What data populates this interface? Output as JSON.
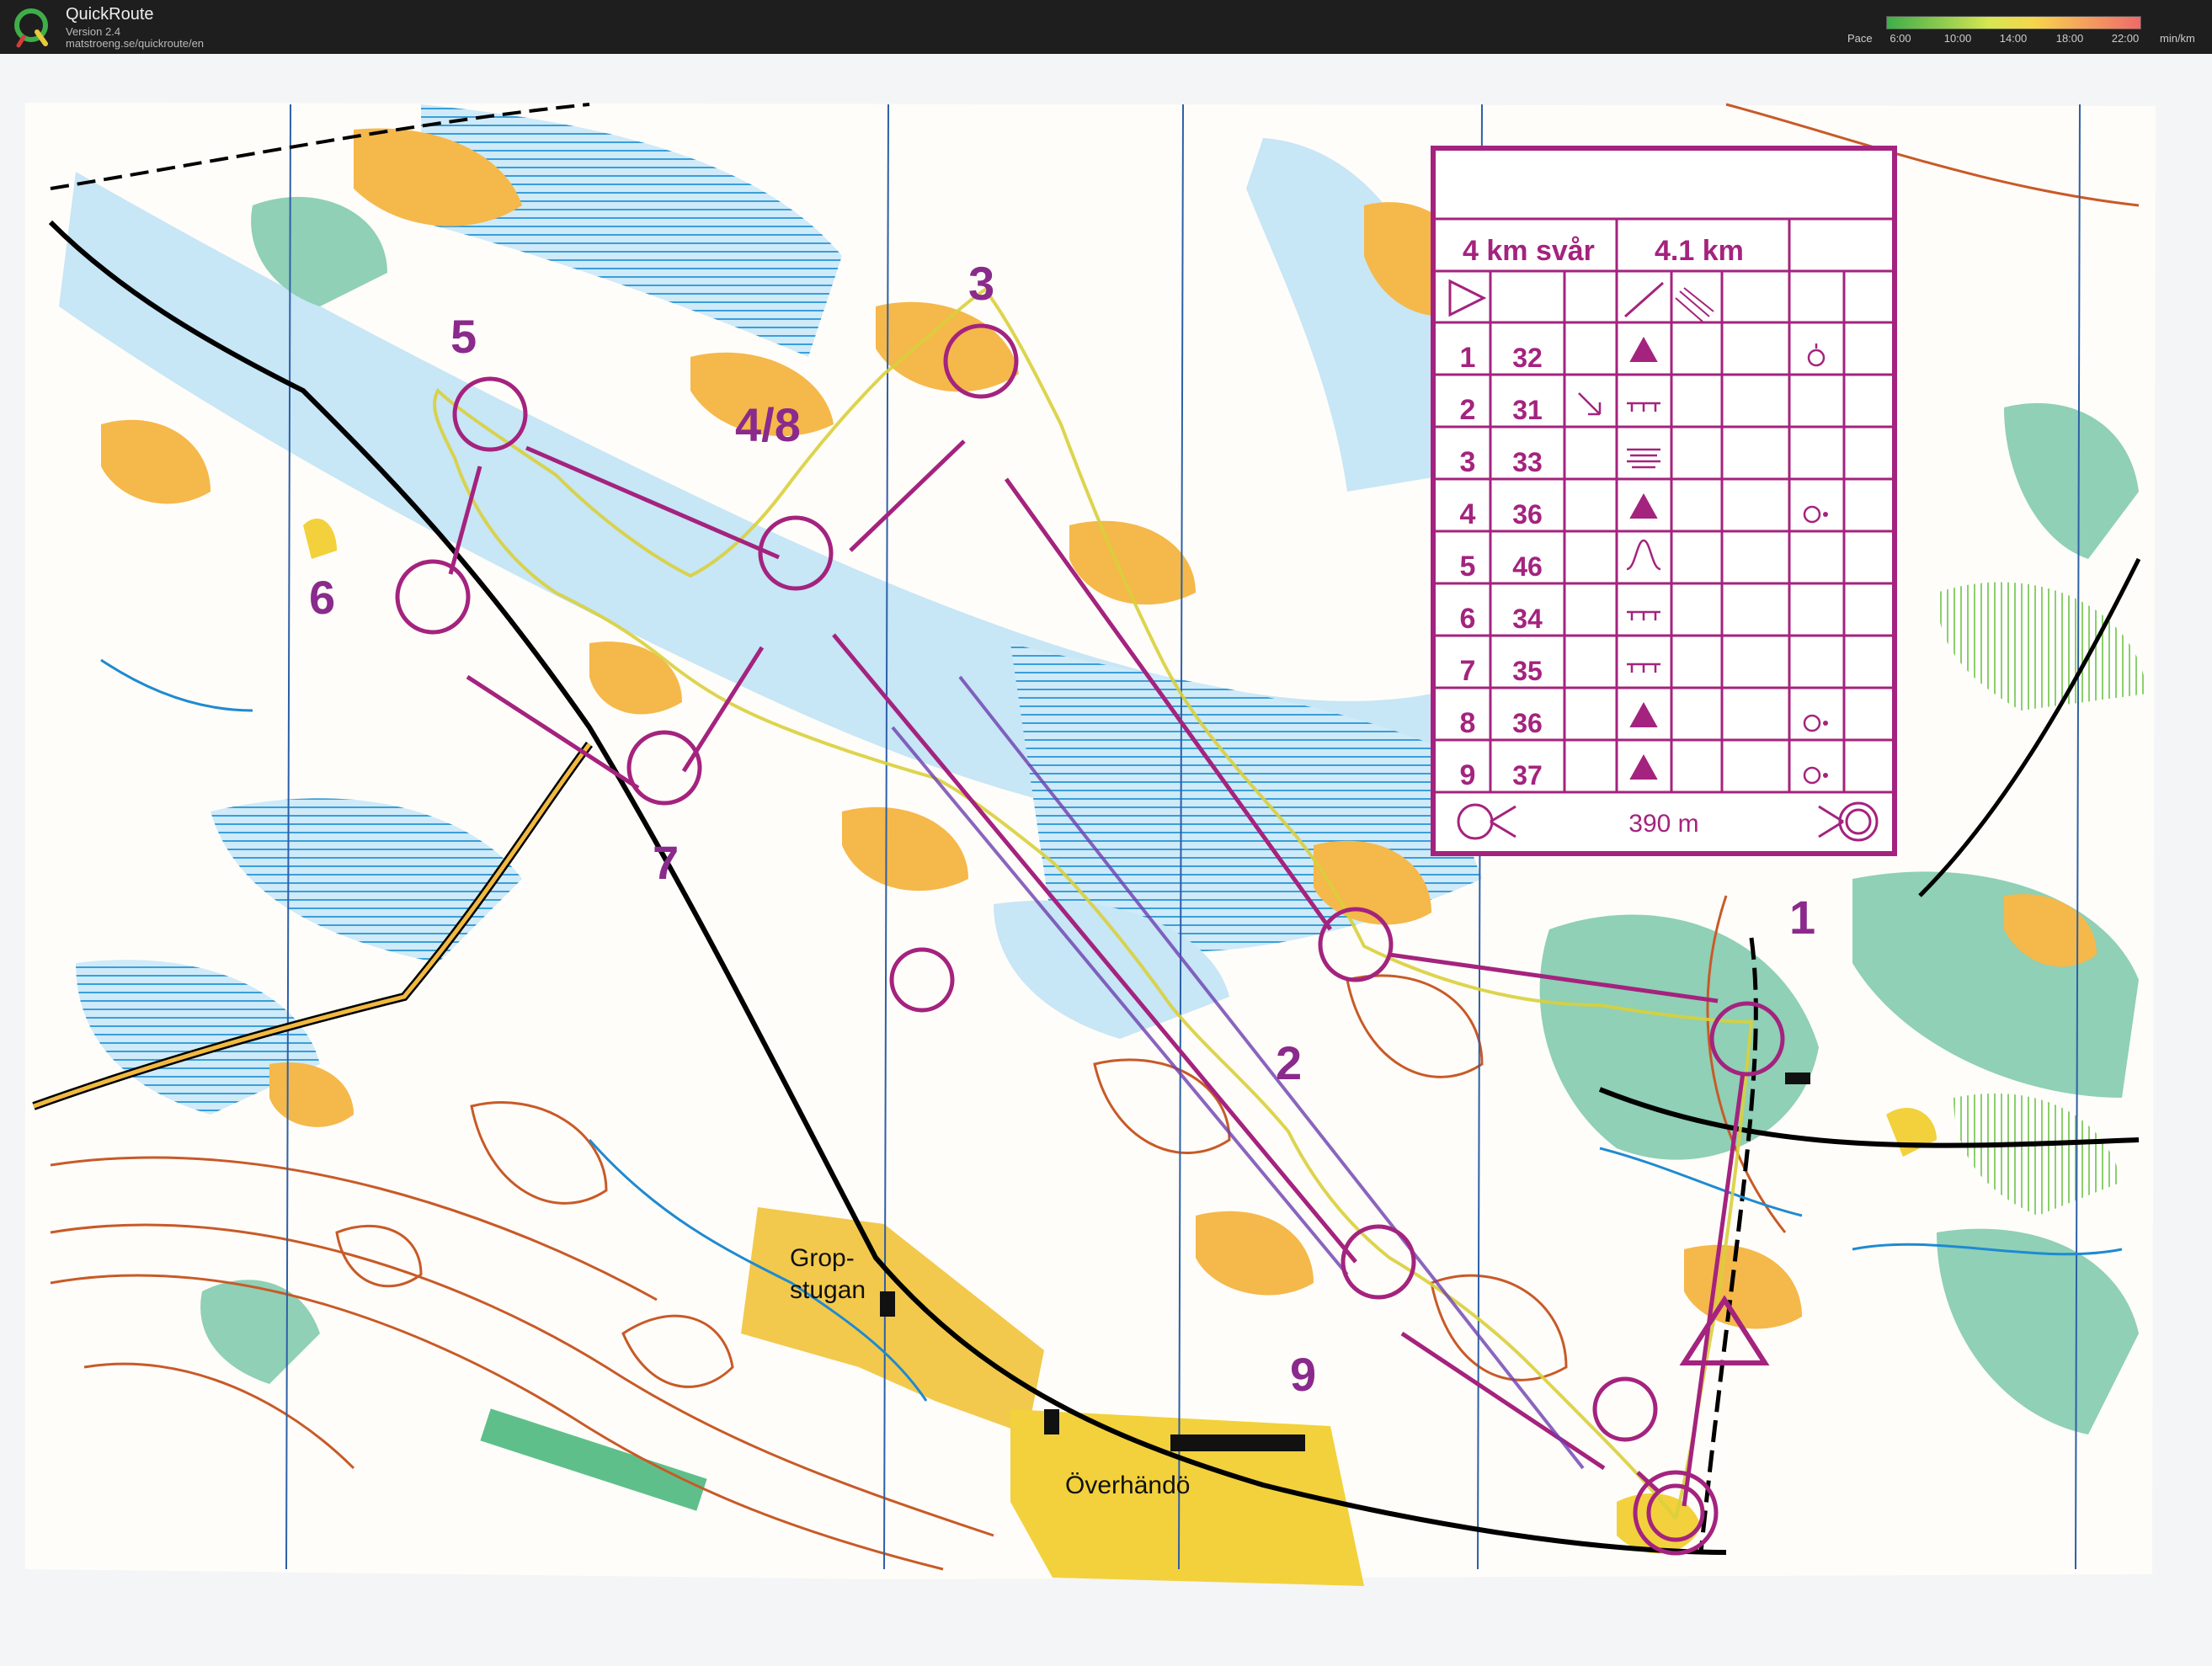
{
  "app": {
    "name": "QuickRoute",
    "version": "Version 2.4",
    "url": "matstroeng.se/quickroute/en",
    "logo_letter": "Q"
  },
  "pace_legend": {
    "label": "Pace",
    "unit": "min/km",
    "ticks": [
      "6:00",
      "10:00",
      "14:00",
      "18:00",
      "22:00"
    ]
  },
  "map": {
    "place_names": {
      "gropstugan_1": "Grop-",
      "gropstugan_2": "stugan",
      "overhando": "Överhändö"
    },
    "control_labels": [
      "1",
      "2",
      "3",
      "4/8",
      "5",
      "6",
      "7",
      "9"
    ],
    "colors": {
      "course": "#a4237e",
      "route": "#7a2ea0",
      "water": "#bfe3f5",
      "open": "#f5b84a",
      "green": "#58b99a",
      "field": "#f2d13c",
      "contour": "#c85a28"
    }
  },
  "control_card": {
    "title": "4 km svår",
    "length": "4.1 km",
    "rows": [
      {
        "num": "1",
        "code": "32"
      },
      {
        "num": "2",
        "code": "31"
      },
      {
        "num": "3",
        "code": "33"
      },
      {
        "num": "4",
        "code": "36"
      },
      {
        "num": "5",
        "code": "46"
      },
      {
        "num": "6",
        "code": "34"
      },
      {
        "num": "7",
        "code": "35"
      },
      {
        "num": "8",
        "code": "36"
      },
      {
        "num": "9",
        "code": "37"
      }
    ],
    "finish_distance": "390 m"
  }
}
